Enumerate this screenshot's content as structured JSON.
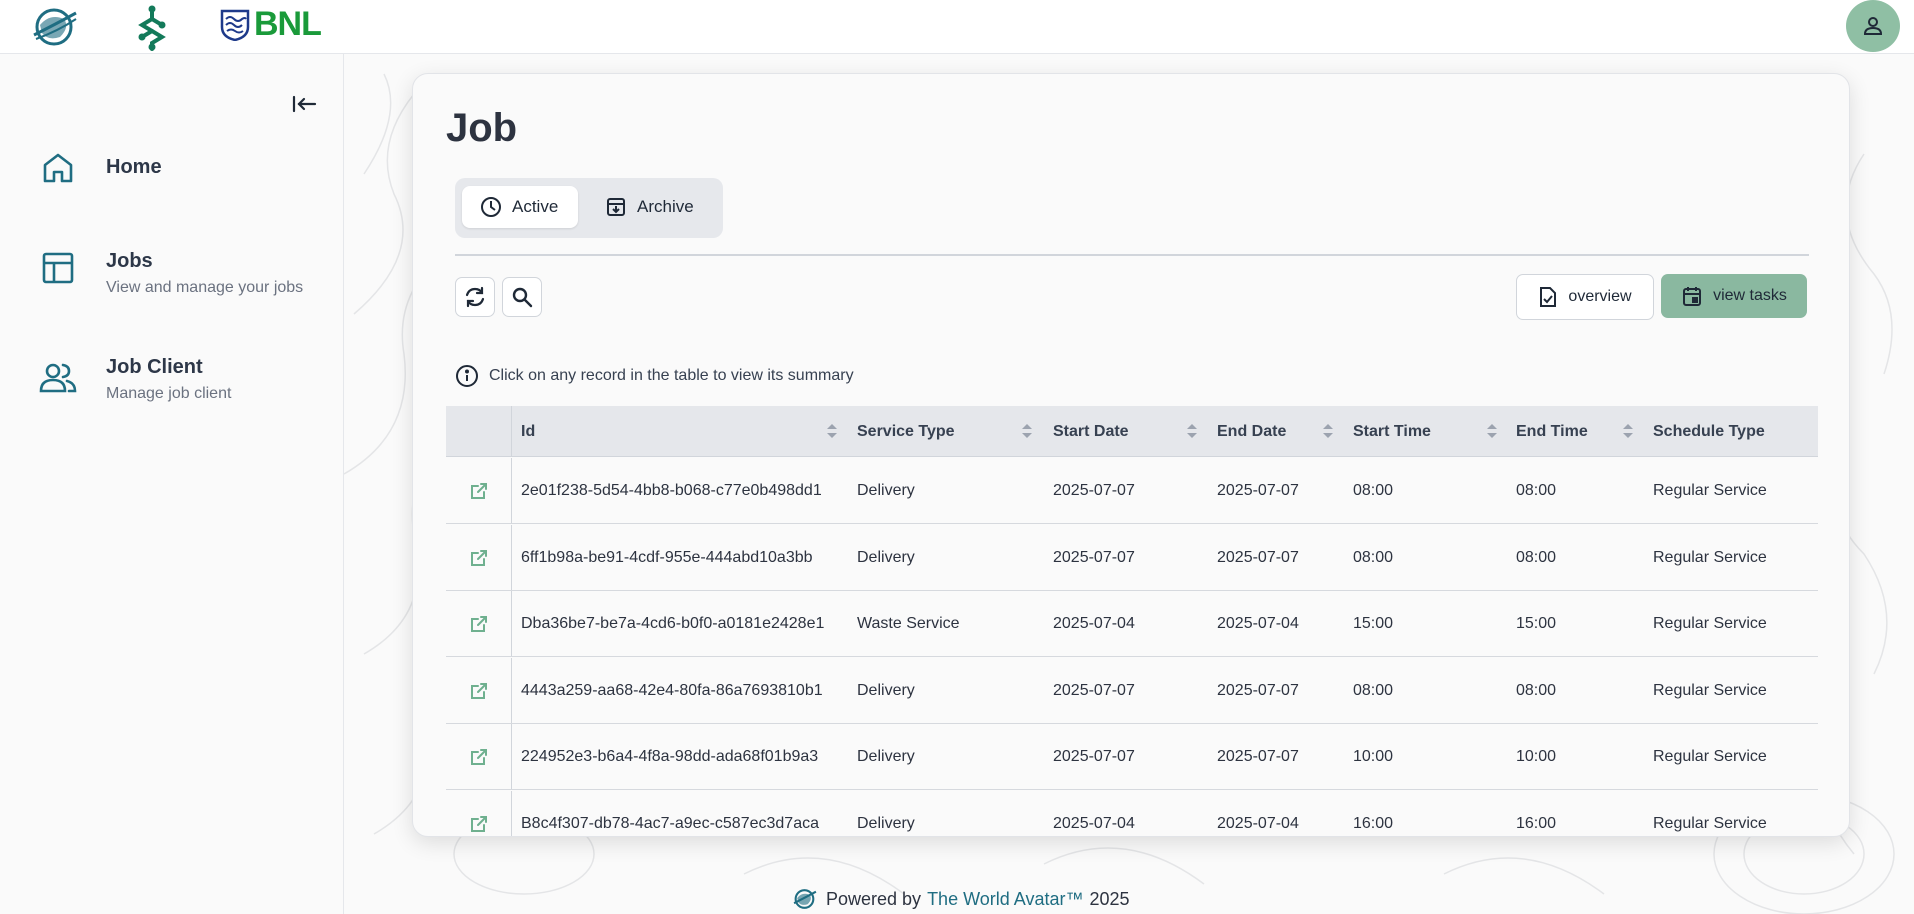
{
  "header": {
    "logo_text": "BNL",
    "user_icon": "user-icon"
  },
  "sidebar": {
    "collapse_icon": "collapse-left-icon",
    "items": [
      {
        "label": "Home",
        "sub": "",
        "icon": "home-icon"
      },
      {
        "label": "Jobs",
        "sub": "View and manage your jobs",
        "icon": "table-layout-icon"
      },
      {
        "label": "Job Client",
        "sub": "Manage job client",
        "icon": "users-icon"
      }
    ]
  },
  "main": {
    "title": "Job",
    "tabs": [
      {
        "label": "Active",
        "icon": "clock-icon",
        "selected": true
      },
      {
        "label": "Archive",
        "icon": "archive-icon",
        "selected": false
      }
    ],
    "toolbar": {
      "refresh_icon": "refresh-icon",
      "search_icon": "search-icon",
      "overview_label": "overview",
      "view_tasks_label": "view tasks"
    },
    "info_text": "Click on any record in the table to view its summary",
    "table": {
      "columns": [
        "Id",
        "Service Type",
        "Start Date",
        "End Date",
        "Start Time",
        "End Time",
        "Schedule Type"
      ],
      "rows": [
        [
          "2e01f238-5d54-4bb8-b068-c77e0b498dd1",
          "Delivery",
          "2025-07-07",
          "2025-07-07",
          "08:00",
          "08:00",
          "Regular Service"
        ],
        [
          "6ff1b98a-be91-4cdf-955e-444abd10a3bb",
          "Delivery",
          "2025-07-07",
          "2025-07-07",
          "08:00",
          "08:00",
          "Regular Service"
        ],
        [
          "Dba36be7-be7a-4cd6-b0f0-a0181e2428e1",
          "Waste Service",
          "2025-07-04",
          "2025-07-04",
          "15:00",
          "15:00",
          "Regular Service"
        ],
        [
          "4443a259-aa68-42e4-80fa-86a7693810b1",
          "Delivery",
          "2025-07-07",
          "2025-07-07",
          "08:00",
          "08:00",
          "Regular Service"
        ],
        [
          "224952e3-b6a4-4f8a-98dd-ada68f01b9a3",
          "Delivery",
          "2025-07-07",
          "2025-07-07",
          "10:00",
          "10:00",
          "Regular Service"
        ],
        [
          "B8c4f307-db78-4ac7-a9ec-c587ec3d7aca",
          "Delivery",
          "2025-07-04",
          "2025-07-04",
          "16:00",
          "16:00",
          "Regular Service"
        ]
      ]
    }
  },
  "footer": {
    "prefix": "Powered by",
    "link": "The World Avatar™",
    "year": "2025"
  },
  "colors": {
    "accent": "#8ab8a0",
    "nav_icon": "#1f6d82",
    "open_icon": "#6fb08f",
    "bnl_green": "#1a9a3a"
  }
}
